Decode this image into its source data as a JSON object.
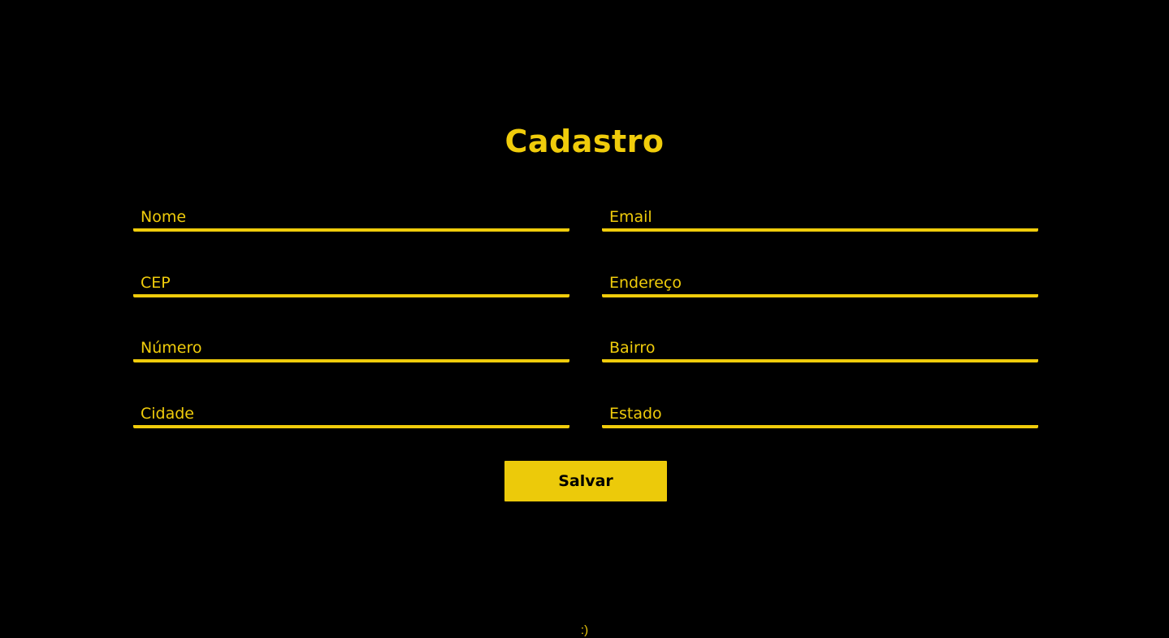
{
  "page": {
    "title": "Cadastro",
    "footer_text": ":)"
  },
  "form": {
    "fields": {
      "nome": {
        "placeholder": "Nome",
        "value": ""
      },
      "email": {
        "placeholder": "Email",
        "value": ""
      },
      "cep": {
        "placeholder": "CEP",
        "value": ""
      },
      "endereco": {
        "placeholder": "Endereço",
        "value": ""
      },
      "numero": {
        "placeholder": "Número",
        "value": ""
      },
      "bairro": {
        "placeholder": "Bairro",
        "value": ""
      },
      "cidade": {
        "placeholder": "Cidade",
        "value": ""
      },
      "estado": {
        "placeholder": "Estado",
        "value": ""
      }
    },
    "submit_label": "Salvar"
  },
  "colors": {
    "background": "#000000",
    "accent": "#f0cc0b",
    "button_text": "#000000"
  }
}
